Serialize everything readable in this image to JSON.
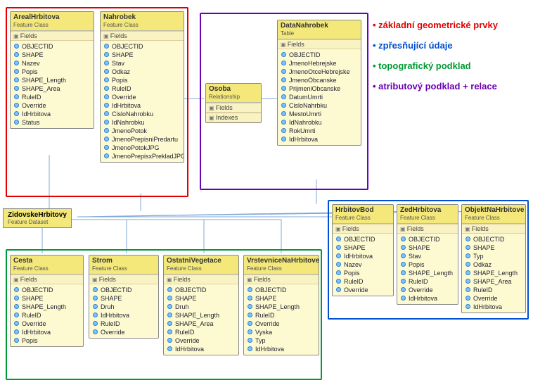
{
  "legend": {
    "red": "• základní geometrické prvky",
    "blue": "• zpřesňující údaje",
    "green": "• topografický podklad",
    "purple": "• atributový podklad + relace"
  },
  "dataset": {
    "title": "ZidovskeHrbitovy",
    "sub": "Feature Dataset"
  },
  "tables": {
    "arealHrbitova": {
      "title": "ArealHrbitova",
      "sub": "Feature Class",
      "fields": [
        "OBJECTID",
        "SHAPE",
        "Nazev",
        "Popis",
        "SHAPE_Length",
        "SHAPE_Area",
        "RuleID",
        "Override",
        "IdHrbitova",
        "Status"
      ]
    },
    "nahrobek": {
      "title": "Nahrobek",
      "sub": "Feature Class",
      "fields": [
        "OBJECTID",
        "SHAPE",
        "Stav",
        "Odkaz",
        "Popis",
        "RuleID",
        "Override",
        "IdHrbitova",
        "CisloNahrobku",
        "IdNahrobku",
        "JmenoPotok",
        "JmenoPrepisniPredartu",
        "JmenoPotokJPG",
        "JmenoPrepisxPrekladJPG"
      ]
    },
    "osoba": {
      "title": "Osoba",
      "sub": "Relationship",
      "sections": [
        "Fields",
        "Indexes"
      ]
    },
    "dataNahrobek": {
      "title": "DataNahrobek",
      "sub": "Table",
      "fields": [
        "OBJECTID",
        "JmenoHebrejske",
        "JmenoOtceHebrejske",
        "JmenoObcanske",
        "PrijmeniObcanske",
        "DatumUmrti",
        "CisloNahrbku",
        "MestoUmrti",
        "IdNahrobku",
        "RokUmrti",
        "IdHrbitova"
      ]
    },
    "cesta": {
      "title": "Cesta",
      "sub": "Feature Class",
      "fields": [
        "OBJECTID",
        "SHAPE",
        "SHAPE_Length",
        "RuleID",
        "Override",
        "IdHrbitova",
        "Popis"
      ]
    },
    "strom": {
      "title": "Strom",
      "sub": "Feature Class",
      "fields": [
        "OBJECTID",
        "SHAPE",
        "Druh",
        "IdHrbitova",
        "RuleID",
        "Override"
      ]
    },
    "ostatniVegetace": {
      "title": "OstatniVegetace",
      "sub": "Feature Class",
      "fields": [
        "OBJECTID",
        "SHAPE",
        "Druh",
        "SHAPE_Length",
        "SHAPE_Area",
        "RuleID",
        "Override",
        "IdHrbitova"
      ]
    },
    "vrstevnice": {
      "title": "VrstevniceNaHrbitove",
      "sub": "Feature Class",
      "fields": [
        "OBJECTID",
        "SHAPE",
        "SHAPE_Length",
        "RuleID",
        "Override",
        "Vyska",
        "Typ",
        "IdHrbitova"
      ]
    },
    "hrbitovBod": {
      "title": "HrbitovBod",
      "sub": "Feature Class",
      "fields": [
        "OBJECTID",
        "SHAPE",
        "IdHrbitova",
        "Nazev",
        "Popis",
        "RuleID",
        "Override"
      ]
    },
    "zedHrbitova": {
      "title": "ZedHrbitova",
      "sub": "Feature Class",
      "fields": [
        "OBJECTID",
        "SHAPE",
        "Stav",
        "Popis",
        "SHAPE_Length",
        "RuleID",
        "Override",
        "IdHrbitova"
      ]
    },
    "objektNaHrbitove": {
      "title": "ObjektNaHrbitove",
      "sub": "Feature Class",
      "fields": [
        "OBJECTID",
        "SHAPE",
        "Typ",
        "Odkaz",
        "SHAPE_Length",
        "SHAPE_Area",
        "RuleID",
        "Override",
        "IdHrbitova"
      ]
    }
  },
  "sectionLabel": "Fields"
}
